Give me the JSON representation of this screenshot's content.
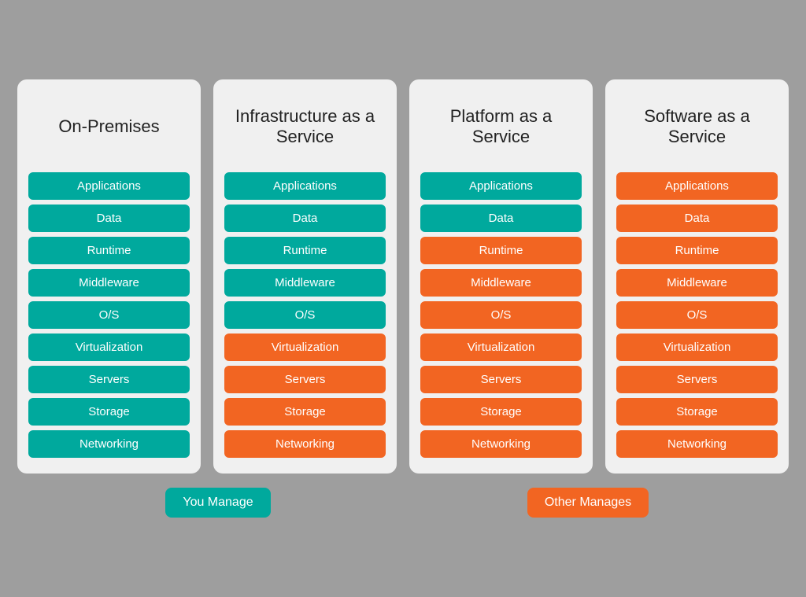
{
  "columns": [
    {
      "id": "on-premises",
      "title": "On-Premises",
      "items": [
        {
          "label": "Applications",
          "color": "teal"
        },
        {
          "label": "Data",
          "color": "teal"
        },
        {
          "label": "Runtime",
          "color": "teal"
        },
        {
          "label": "Middleware",
          "color": "teal"
        },
        {
          "label": "O/S",
          "color": "teal"
        },
        {
          "label": "Virtualization",
          "color": "teal"
        },
        {
          "label": "Servers",
          "color": "teal"
        },
        {
          "label": "Storage",
          "color": "teal"
        },
        {
          "label": "Networking",
          "color": "teal"
        }
      ]
    },
    {
      "id": "iaas",
      "title": "Infrastructure as a Service",
      "items": [
        {
          "label": "Applications",
          "color": "teal"
        },
        {
          "label": "Data",
          "color": "teal"
        },
        {
          "label": "Runtime",
          "color": "teal"
        },
        {
          "label": "Middleware",
          "color": "teal"
        },
        {
          "label": "O/S",
          "color": "teal"
        },
        {
          "label": "Virtualization",
          "color": "orange"
        },
        {
          "label": "Servers",
          "color": "orange"
        },
        {
          "label": "Storage",
          "color": "orange"
        },
        {
          "label": "Networking",
          "color": "orange"
        }
      ]
    },
    {
      "id": "paas",
      "title": "Platform as a Service",
      "items": [
        {
          "label": "Applications",
          "color": "teal"
        },
        {
          "label": "Data",
          "color": "teal"
        },
        {
          "label": "Runtime",
          "color": "orange"
        },
        {
          "label": "Middleware",
          "color": "orange"
        },
        {
          "label": "O/S",
          "color": "orange"
        },
        {
          "label": "Virtualization",
          "color": "orange"
        },
        {
          "label": "Servers",
          "color": "orange"
        },
        {
          "label": "Storage",
          "color": "orange"
        },
        {
          "label": "Networking",
          "color": "orange"
        }
      ]
    },
    {
      "id": "saas",
      "title": "Software as a Service",
      "items": [
        {
          "label": "Applications",
          "color": "orange"
        },
        {
          "label": "Data",
          "color": "orange"
        },
        {
          "label": "Runtime",
          "color": "orange"
        },
        {
          "label": "Middleware",
          "color": "orange"
        },
        {
          "label": "O/S",
          "color": "orange"
        },
        {
          "label": "Virtualization",
          "color": "orange"
        },
        {
          "label": "Servers",
          "color": "orange"
        },
        {
          "label": "Storage",
          "color": "orange"
        },
        {
          "label": "Networking",
          "color": "orange"
        }
      ]
    }
  ],
  "legend": {
    "you_manage": "You Manage",
    "other_manages": "Other Manages"
  }
}
